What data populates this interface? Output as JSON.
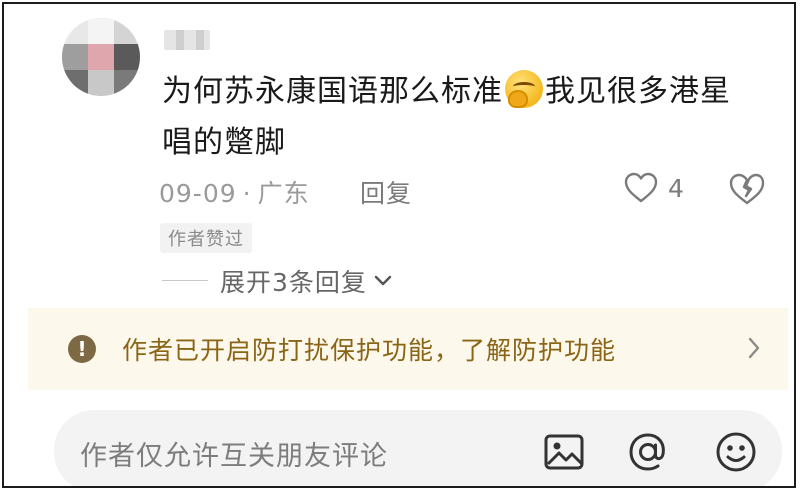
{
  "comment": {
    "text_line1": "为何苏永康国语那么标准",
    "text_after_emoji": "我见很多港星",
    "text_line2": "唱的蹩脚",
    "date": "09-09",
    "separator": "·",
    "location": "广东",
    "reply_label": "回复",
    "like_count": "4",
    "author_badge": "作者赞过",
    "expand_label": "展开3条回复"
  },
  "notice": {
    "text": "作者已开启防打扰保护功能，了解防护功能"
  },
  "input": {
    "placeholder": "作者仅允许互关朋友评论"
  },
  "colors": {
    "notice_bg": "#fdf8ec",
    "notice_text": "#8b6516",
    "meta_text": "#9a9a9a"
  },
  "icons": [
    "avatar-image",
    "smirk-emoji",
    "heart-icon",
    "broken-heart-icon",
    "chevron-down-icon",
    "warning-icon",
    "chevron-right-icon",
    "image-icon",
    "at-icon",
    "emoji-icon"
  ]
}
